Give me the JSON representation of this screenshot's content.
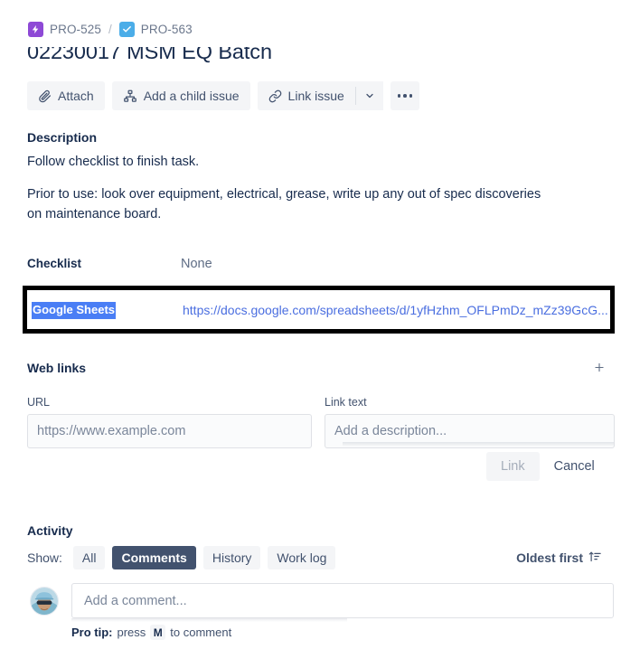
{
  "breadcrumb": {
    "parent": {
      "key": "PRO-525",
      "icon": "epic-lightning-icon",
      "color": "#8e49d6"
    },
    "separator": "/",
    "current": {
      "key": "PRO-563",
      "icon": "task-check-icon",
      "color": "#4bade8"
    }
  },
  "issue": {
    "title": "02230017 MSM EQ Batch"
  },
  "actions": {
    "attach": "Attach",
    "add_child": "Add a child issue",
    "link_issue": "Link issue",
    "chevron": "chevron-down-icon",
    "more": "more-actions-icon"
  },
  "description": {
    "heading": "Description",
    "paragraph1": "Follow checklist to finish task.",
    "paragraph2": "Prior to use: look over equipment, electrical, grease, write up any out of spec discoveries on maintenance board."
  },
  "checklist": {
    "label": "Checklist",
    "value": "None"
  },
  "linked_item": {
    "title": "Google Sheets",
    "url": "https://docs.google.com/spreadsheets/d/1yfHzhm_OFLPmDz_mZz39GcG...",
    "selection_color": "#4a7ef5",
    "annotation_color": "#000000"
  },
  "web_links": {
    "heading": "Web links",
    "add_icon": "plus-icon",
    "url_field": {
      "label": "URL",
      "value": "",
      "placeholder": "https://www.example.com"
    },
    "link_text_field": {
      "label": "Link text",
      "value": "",
      "placeholder": "Add a description..."
    },
    "submit_label": "Link",
    "cancel_label": "Cancel"
  },
  "activity": {
    "heading": "Activity",
    "show_label": "Show:",
    "filters": [
      {
        "label": "All",
        "active": false
      },
      {
        "label": "Comments",
        "active": true
      },
      {
        "label": "History",
        "active": false
      },
      {
        "label": "Work log",
        "active": false
      }
    ],
    "sort": {
      "label": "Oldest first",
      "icon": "sort-ascending-icon"
    },
    "comment_box": {
      "placeholder": "Add a comment...",
      "value": "",
      "avatar": "user-avatar"
    },
    "pro_tip": {
      "prefix": "Pro tip:",
      "middle": "press",
      "key": "M",
      "suffix": "to comment"
    }
  }
}
